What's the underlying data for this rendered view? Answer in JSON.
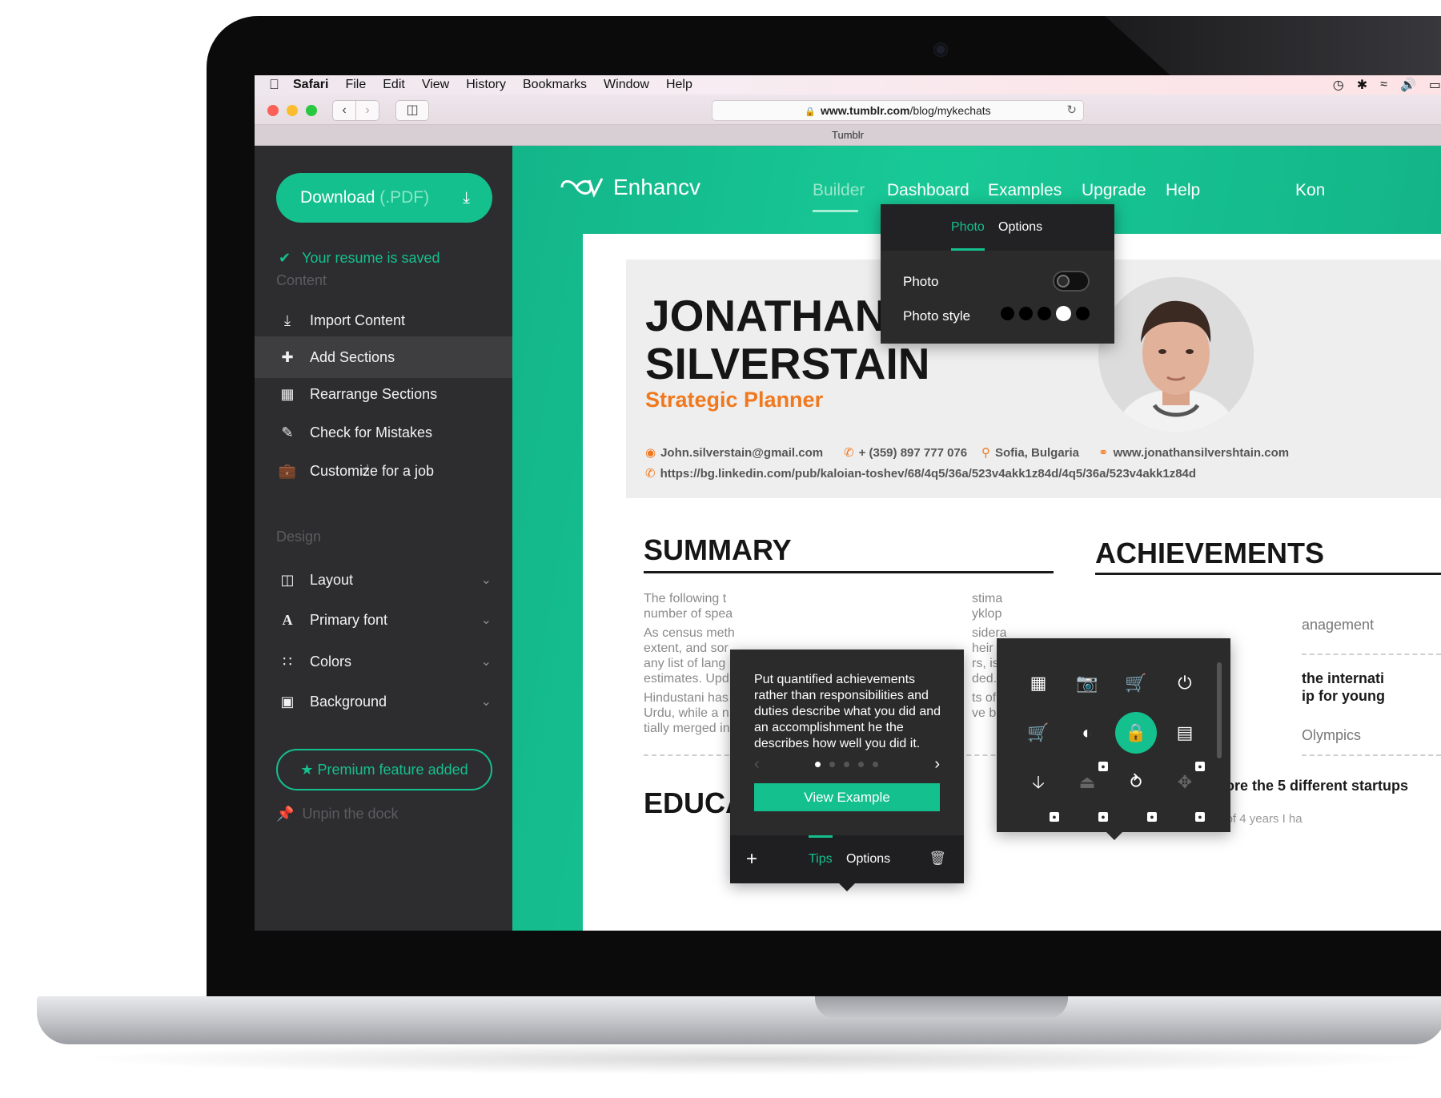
{
  "menubar": {
    "apple": "",
    "items": [
      "Safari",
      "File",
      "Edit",
      "View",
      "History",
      "Bookmarks",
      "Window",
      "Help"
    ]
  },
  "browser": {
    "url_domain": "www.tumblr.com",
    "url_path": "/blog/mykechats",
    "tab_title": "Tumblr"
  },
  "sidebar": {
    "download_label": "Download",
    "download_format": "(.PDF)",
    "saved_status": "Your resume is saved",
    "content_label": "Content",
    "content_items": [
      {
        "label": "Import Content",
        "icon": "import-icon"
      },
      {
        "label": "Add Sections",
        "icon": "add-sections-icon"
      },
      {
        "label": "Rearrange Sections",
        "icon": "rearrange-icon"
      },
      {
        "label": "Check for Mistakes",
        "icon": "pencil-icon"
      },
      {
        "label": "Customize for a job",
        "icon": "briefcase-icon"
      }
    ],
    "design_label": "Design",
    "design_items": [
      {
        "label": "Layout",
        "icon": "layout-icon"
      },
      {
        "label": "Primary font",
        "icon": "font-icon"
      },
      {
        "label": "Colors",
        "icon": "colors-icon"
      },
      {
        "label": "Background",
        "icon": "background-icon"
      }
    ],
    "premium_label": "Premium feature added",
    "unpin_label": "Unpin the dock"
  },
  "topnav": {
    "logo_text": "Enhancv",
    "items": [
      "Builder",
      "Dashboard",
      "Examples",
      "Upgrade",
      "Help",
      "Kon"
    ],
    "active": "Builder"
  },
  "resume": {
    "first_name": "JONATHAN",
    "last_name": "SILVERSTAIN",
    "role": "Strategic Planner",
    "email": "John.silverstain@gmail.com",
    "phone": "+ (359) 897 777 076",
    "location": "Sofia, Bulgaria",
    "website": "www.jonathansilvershtain.com",
    "linkedin": "https://bg.linkedin.com/pub/kaloian-toshev/68/4q5/36a/523v4akk1z84d/4q5/36a/523v4akk1z84d",
    "summary_heading": "SUMMARY",
    "achievements_heading": "ACHIEVEMENTS",
    "education_heading": "EDUCA",
    "summary_lines_1": [
      "The following t",
      "number of spea"
    ],
    "summary_lines_2": [
      "As census meth",
      "extent, and sor",
      "any list of lang",
      "estimates. Upd"
    ],
    "summary_lines_3": [
      "Hindustani has",
      "Urdu, while a n",
      "tially merged in"
    ],
    "summary_right": [
      "stima",
      "yklop",
      "sidera",
      "heir c",
      "rs, is",
      "ded.",
      "ts of",
      "ve bee"
    ],
    "ach_partial_1": "anagement",
    "ach_partial_2a": "the internati",
    "ach_partial_2b": "ip for young",
    "ach_partial_3": "Olympics",
    "founded": "Founded more the 5 different startups",
    "founded_sub": "In the lifespan of 4 years I ha"
  },
  "photo_popup": {
    "tab_photo": "Photo",
    "tab_options": "Options",
    "photo_label": "Photo",
    "photo_style_label": "Photo style",
    "photo_toggle_on": false,
    "photo_style_selected": 4
  },
  "tips_popup": {
    "text": "Put quantified achievements rather than responsibilities and duties describe what you did and an accomplishment  he the describes how well you did it.",
    "page": 1,
    "pages": 5,
    "view_example": "View Example",
    "tab_tips": "Tips",
    "tab_options": "Options"
  },
  "icon_popup": {
    "icons": [
      "qr-icon",
      "camera-icon",
      "cart-icon",
      "power-icon",
      "cart-icon",
      "contrast-icon",
      "lock-icon",
      "card-icon",
      "download-arrow-icon",
      "eject-icon",
      "rss-icon",
      "move-icon"
    ],
    "selected": "lock-icon"
  },
  "colors": {
    "accent": "#14c08e",
    "sidebar": "#2d2d2f",
    "orange": "#f0781e"
  }
}
